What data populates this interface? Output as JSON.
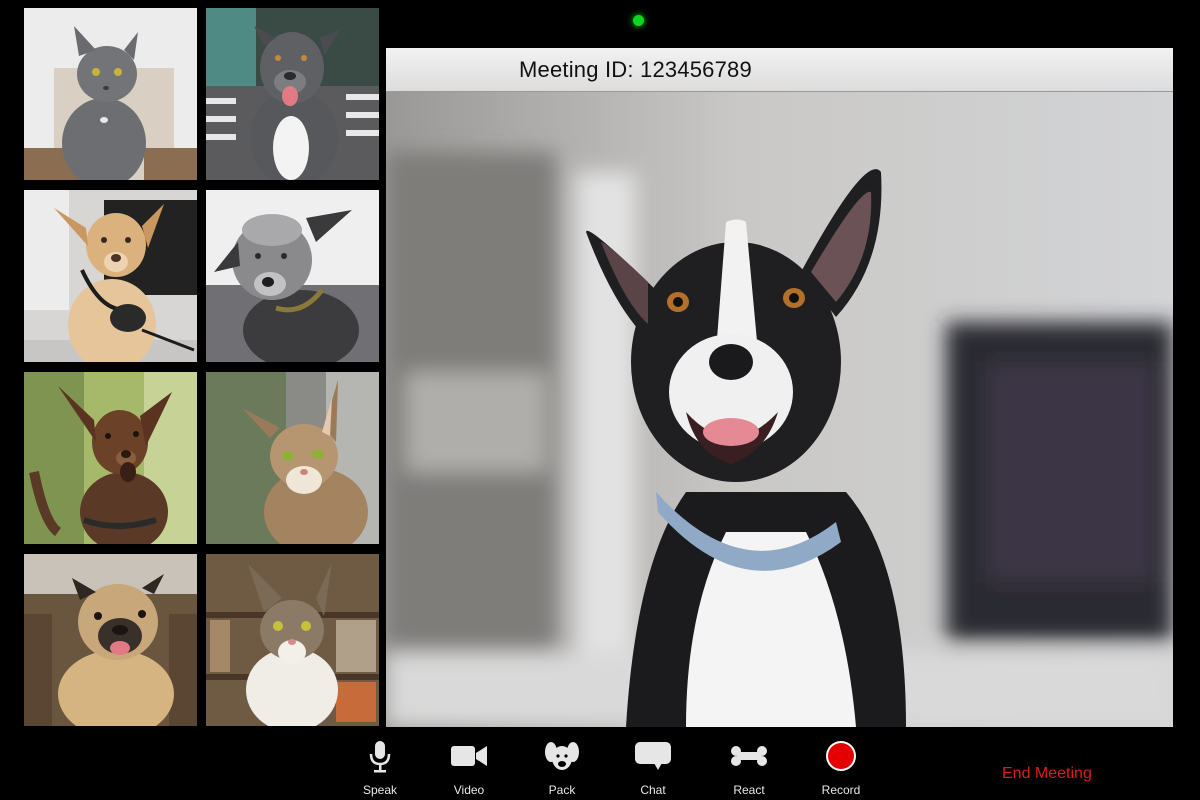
{
  "window": {
    "meeting_id": "Meeting ID: 123456789"
  },
  "status": {
    "camera_indicator_color": "#0fd51f"
  },
  "participants": [
    {
      "animal": "cat",
      "description": "grey cat in white chair"
    },
    {
      "animal": "dog",
      "description": "grey pit bull on striped couch"
    },
    {
      "animal": "dog",
      "description": "tan dog with headset"
    },
    {
      "animal": "dog",
      "description": "grey scruffy terrier"
    },
    {
      "animal": "dog",
      "description": "brown chihuahua mix"
    },
    {
      "animal": "cat",
      "description": "tabby cat"
    },
    {
      "animal": "dog",
      "description": "pug in leather chair"
    },
    {
      "animal": "cat",
      "description": "tabby and white cat by bookshelf"
    }
  ],
  "active_speaker": {
    "animal": "dog",
    "description": "black and white dog with blue collar"
  },
  "toolbar": {
    "items": [
      {
        "label": "Speak",
        "icon": "microphone-icon"
      },
      {
        "label": "Video",
        "icon": "video-camera-icon"
      },
      {
        "label": "Pack",
        "icon": "dog-head-icon"
      },
      {
        "label": "Chat",
        "icon": "chat-bubble-icon"
      },
      {
        "label": "React",
        "icon": "bone-icon"
      },
      {
        "label": "Record",
        "icon": "record-icon"
      }
    ],
    "record_color": "#e40000",
    "end_meeting_label": "End Meeting",
    "end_meeting_color": "#e01b1b"
  }
}
